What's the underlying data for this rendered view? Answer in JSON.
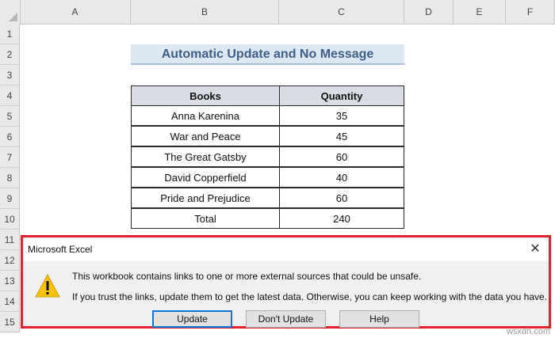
{
  "columns": [
    "A",
    "B",
    "C",
    "D",
    "E",
    "F"
  ],
  "rows": [
    "1",
    "2",
    "3",
    "4",
    "5",
    "6",
    "7",
    "8",
    "9",
    "10",
    "11",
    "12",
    "13",
    "14",
    "15"
  ],
  "title": "Automatic Update and No Message",
  "table": {
    "headers": [
      "Books",
      "Quantity"
    ],
    "rows": [
      [
        "Anna Karenina",
        "35"
      ],
      [
        "War and Peace",
        "45"
      ],
      [
        "The Great Gatsby",
        "60"
      ],
      [
        "David Copperfield",
        "40"
      ],
      [
        "Pride and Prejudice",
        "60"
      ],
      [
        "Total",
        "240"
      ]
    ]
  },
  "dialog": {
    "title": "Microsoft Excel",
    "close_glyph": "✕",
    "icon": "warning-icon",
    "message_line1": "This workbook contains links to one or more external sources that could be unsafe.",
    "message_line2": "If you trust the links, update them to get the latest data. Otherwise, you can keep working with the data you have.",
    "buttons": [
      "Update",
      "Don't Update",
      "Help"
    ]
  },
  "watermark": "wsxdn.com",
  "colors": {
    "title_text": "#3f5f86",
    "title_fill": "#dde7f1",
    "header_fill": "#d9dde3",
    "dialog_highlight": "#e0202a",
    "primary_button_border": "#0078d7"
  }
}
